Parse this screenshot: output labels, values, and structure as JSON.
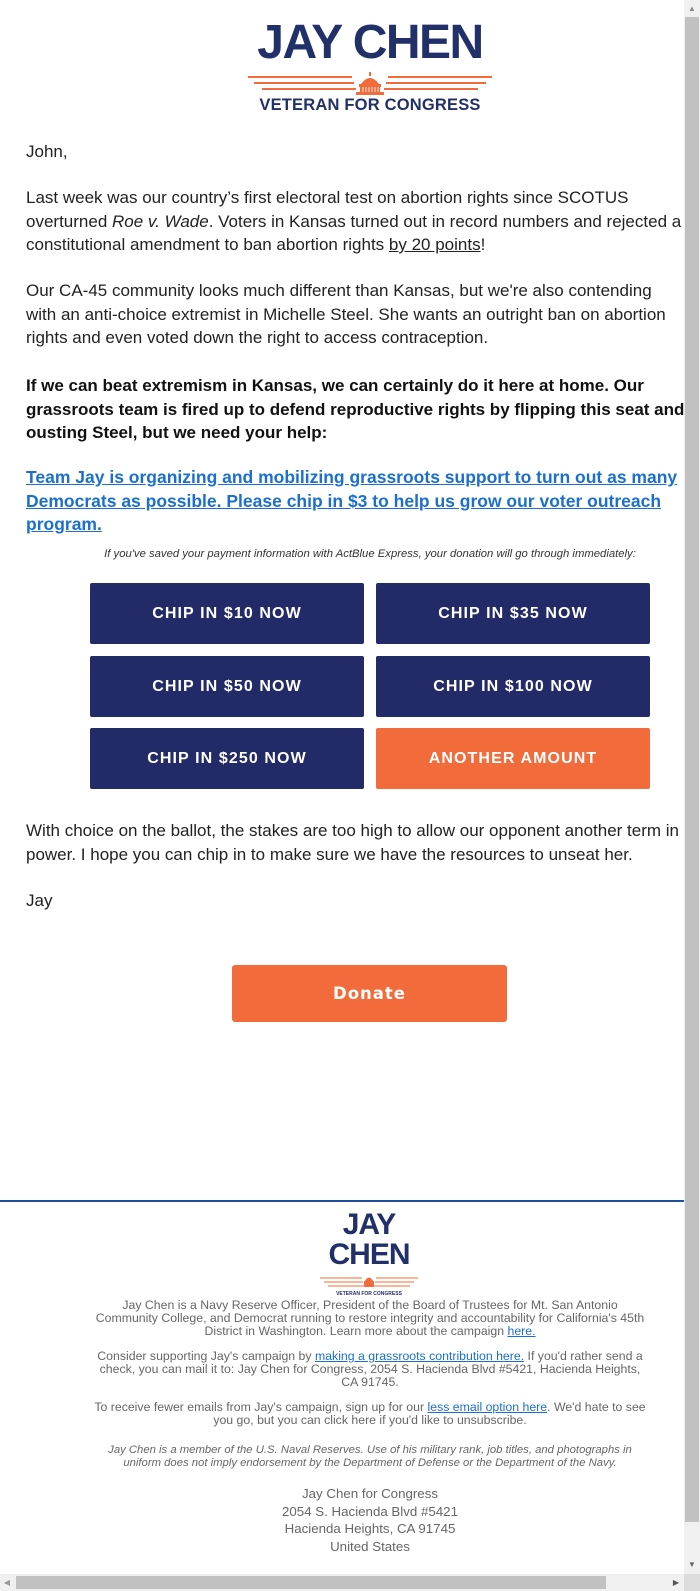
{
  "header": {
    "logo_title": "JAY CHEN",
    "logo_subtitle": "VETERAN FOR CONGRESS"
  },
  "body": {
    "greeting": "John,",
    "p1": {
      "line1": "Last week was our country’s first electoral test on abortion rights since SCOTUS",
      "line2_a": "overturned ",
      "line2_em": "Roe v. Wade",
      "line2_b": ". Voters in Kansas turned out in record numbers and rejected a",
      "line3_a": "constitutional amendment to ban abortion rights ",
      "line3_link": "by 20 points",
      "line3_b": "!"
    },
    "p2": [
      "Our CA-45 community looks much different than Kansas, but we're also contending",
      "with an anti-choice extremist in Michelle Steel. She wants an outright ban on abortion",
      "rights and even voted down the right to access contraception."
    ],
    "p3": [
      "If we can beat extremism in Kansas, we can certainly do it here at home. Our",
      "grassroots team is fired up to defend reproductive rights by flipping this seat and",
      "ousting Steel, but we need your help:"
    ],
    "p4_link": [
      "Team Jay is organizing and mobilizing grassroots support to turn out as many",
      "Democrats as possible. Please chip in $3 to help us grow our voter outreach",
      "program."
    ],
    "actblue_note": "If you've saved your payment information with ActBlue Express, your donation will go through immediately:",
    "buttons": [
      {
        "label": "CHIP IN $10 NOW",
        "amount": 10
      },
      {
        "label": "CHIP IN $35 NOW",
        "amount": 35
      },
      {
        "label": "CHIP IN $50 NOW",
        "amount": 50
      },
      {
        "label": "CHIP IN $100 NOW",
        "amount": 100
      },
      {
        "label": "CHIP IN $250 NOW",
        "amount": 250
      },
      {
        "label": "ANOTHER AMOUNT",
        "amount": null
      }
    ],
    "p5": [
      "With choice on the ballot, the stakes are too high to allow our opponent another term in",
      "power. I hope you can chip in to make sure we have the resources to unseat her."
    ],
    "signature": "Jay",
    "donate_label": "Donate"
  },
  "footer": {
    "logo_title_1": "JAY",
    "logo_title_2": "CHEN",
    "logo_subtitle": "VETERAN FOR CONGRESS",
    "bio": {
      "line1": "Jay Chen is a Navy Reserve Officer, President of the Board of Trustees for Mt. San Antonio",
      "line2": "Community College, and Democrat running to restore integrity and accountability for California's 45th",
      "line3": "District in Washington. Learn more about the campaign ",
      "link": "here."
    },
    "support": {
      "a": "Consider supporting Jay's campaign by ",
      "link": "making a grassroots contribution here.",
      "b": " If you'd rather send a",
      "line2": "check, you can mail it to: Jay Chen for Congress, 2054 S. Hacienda Blvd #5421, Hacienda Heights,",
      "line3": "CA 91745."
    },
    "fewer": {
      "a": "To receive fewer emails from Jay's campaign, sign up for our ",
      "link": "less email option here",
      "b": ". We'd hate to see",
      "line2": "you go, but you can click here if you'd like to unsubscribe."
    },
    "disclaimer": {
      "line1": "Jay Chen is a member of the U.S. Naval Reserves. Use of his military rank, job titles, and photographs in",
      "line2": "uniform does not imply endorsement by the Department of Defense or the Department of the Navy."
    },
    "address": [
      "Jay Chen for Congress",
      "2054 S. Hacienda Blvd #5421",
      "Hacienda Heights, CA 91745",
      "United States"
    ]
  },
  "colors": {
    "navy": "#222b68",
    "orange": "#f26b3a",
    "link_blue": "#1a6fd0",
    "divider_blue": "#1f4f9a"
  }
}
